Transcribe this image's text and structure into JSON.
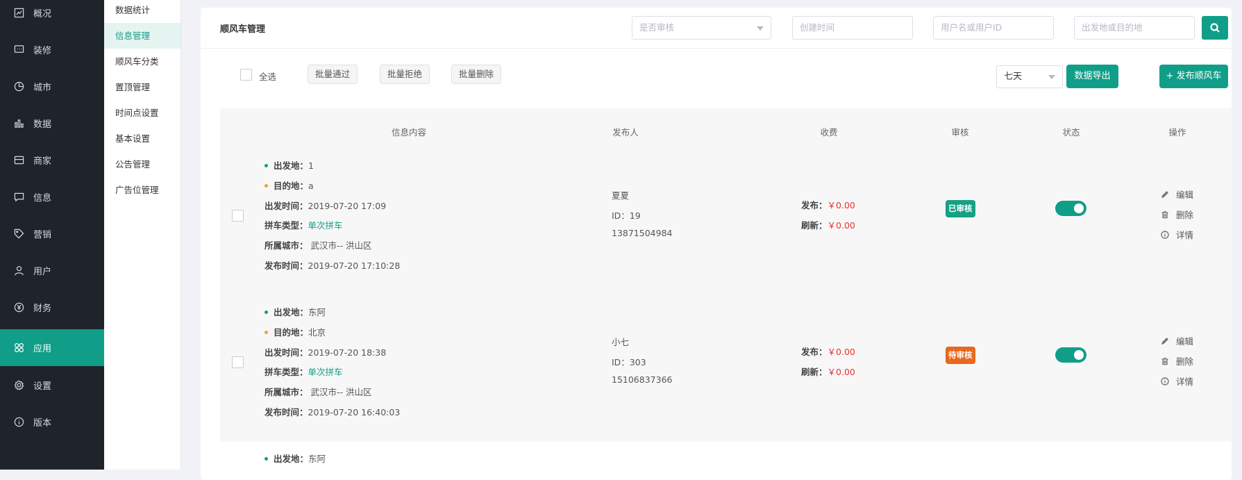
{
  "sidebar": {
    "items": [
      {
        "label": "概况",
        "icon": "overview-icon"
      },
      {
        "label": "装修",
        "icon": "decorate-icon"
      },
      {
        "label": "城市",
        "icon": "city-icon"
      },
      {
        "label": "数据",
        "icon": "bar-chart-icon"
      },
      {
        "label": "商家",
        "icon": "store-icon"
      },
      {
        "label": "信息",
        "icon": "message-icon"
      },
      {
        "label": "营销",
        "icon": "tag-icon"
      },
      {
        "label": "用户",
        "icon": "user-icon"
      },
      {
        "label": "财务",
        "icon": "yen-icon"
      },
      {
        "label": "应用",
        "icon": "apps-icon"
      },
      {
        "label": "设置",
        "icon": "gear-icon"
      },
      {
        "label": "版本",
        "icon": "info-icon"
      }
    ],
    "active_index": 9,
    "active_color": "#119e88"
  },
  "submenu": {
    "items": [
      "数据统计",
      "信息管理",
      "顺风车分类",
      "置顶管理",
      "时间点设置",
      "基本设置",
      "公告管理",
      "广告位管理"
    ],
    "active_index": 1
  },
  "header": {
    "title": "顺风车管理",
    "review_select_placeholder": "是否审核",
    "created_time_placeholder": "创建时间",
    "user_placeholder": "用户名或用户ID",
    "place_placeholder": "出发地或目的地"
  },
  "toolbar": {
    "select_all": "全选",
    "batch_pass": "批量通过",
    "batch_reject": "批量拒绝",
    "batch_delete": "批量删除",
    "days_value": "七天",
    "export": "数据导出",
    "publish": "+ 发布顺风车"
  },
  "table": {
    "columns": [
      "信息内容",
      "发布人",
      "收费",
      "审核",
      "状态",
      "操作"
    ],
    "labels": {
      "from": "出发地：",
      "to": "目的地：",
      "depart_time": "出发时间：",
      "carpool_type": "拼车类型：",
      "city": "所属城市：",
      "publish_time": "发布时间：",
      "fee_publish": "发布：",
      "fee_refresh": "刷新："
    },
    "actions": {
      "edit": "编辑",
      "delete": "删除",
      "detail": "详情"
    },
    "rows": [
      {
        "from": "1",
        "to": "a",
        "depart_time": "2019-07-20 17:09",
        "carpool_type": "单次拼车",
        "city": "武汉市-- 洪山区",
        "publish_time": "2019-07-20 17:10:28",
        "publisher_name": "夏夏",
        "publisher_id": "ID：19",
        "publisher_phone": "13871504984",
        "fee_publish": "￥0.00",
        "fee_refresh": "￥0.00",
        "review": "已审核",
        "review_color": "#16a085",
        "status_on": true
      },
      {
        "from": "东阿",
        "to": "北京",
        "depart_time": "2019-07-20 18:38",
        "carpool_type": "单次拼车",
        "city": "武汉市-- 洪山区",
        "publish_time": "2019-07-20 16:40:03",
        "publisher_name": "小七",
        "publisher_id": "ID：303",
        "publisher_phone": "15106837366",
        "fee_publish": "￥0.00",
        "fee_refresh": "￥0.00",
        "review": "待审核",
        "review_color": "#e8681e",
        "status_on": true
      },
      {
        "from": "东阿"
      }
    ]
  }
}
